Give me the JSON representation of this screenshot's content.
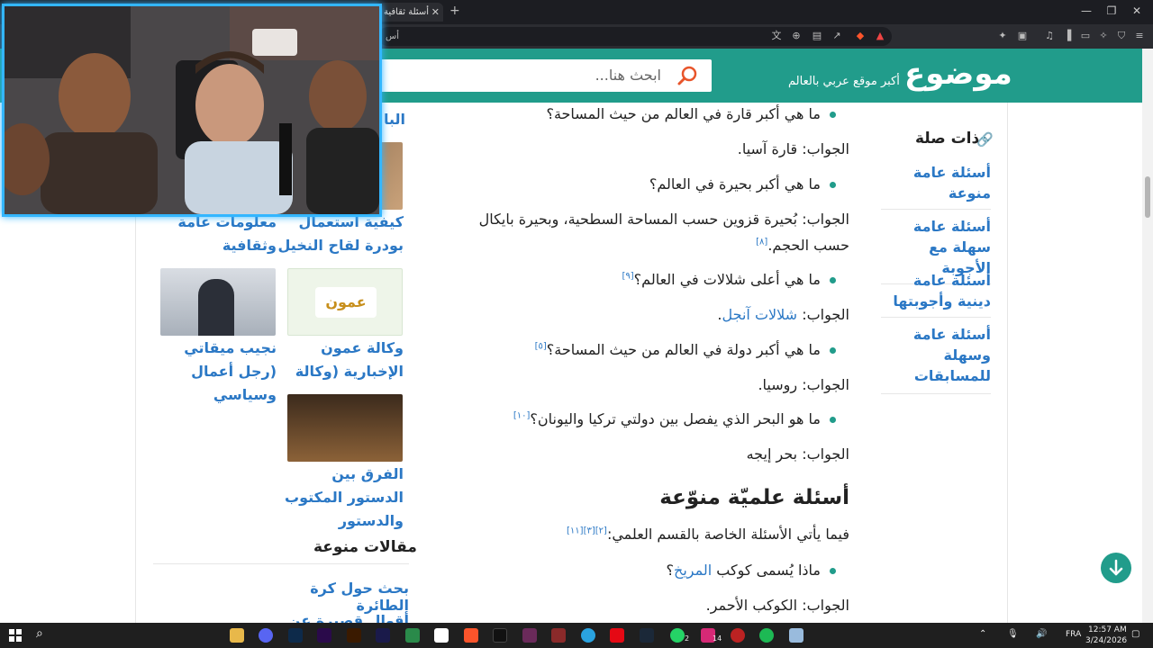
{
  "browser": {
    "tab_title": "أسئلة ثقافية",
    "tab_close": "✕",
    "new_tab": "+",
    "url_fragment": "أس",
    "window_controls": [
      "—",
      "❐",
      "✕"
    ]
  },
  "site": {
    "logo": "موضوع",
    "tagline": "أكبر موقع عربي بالعالم",
    "search_placeholder": "ابحث هنا..."
  },
  "article": {
    "items": [
      {
        "type": "q",
        "text": "ما هي أكبر قارة في العالم من حيث المساحة؟"
      },
      {
        "type": "a",
        "label": "الجواب:",
        "text": "قارة آسيا."
      },
      {
        "type": "q",
        "text": "ما هي أكبر بحيرة في العالم؟"
      },
      {
        "type": "a",
        "label": "الجواب:",
        "text": "بُحيرة قزوين حسب المساحة السطحية، وبحيرة بايكال"
      },
      {
        "type": "a2",
        "text": "حسب الحجم.",
        "sup": "[٨]"
      },
      {
        "type": "q",
        "text": "ما هي أعلى شلالات في العالم؟",
        "sup": "[٩]"
      },
      {
        "type": "a",
        "label": "الجواب:",
        "link": "شلالات آنجل",
        "text": "."
      },
      {
        "type": "q",
        "text": "ما هي أكبر دولة في العالم من حيث المساحة؟",
        "sup": "[٥]"
      },
      {
        "type": "a",
        "label": "الجواب:",
        "text": "روسيا."
      },
      {
        "type": "q",
        "text": "ما هو البحر الذي يفصل بين دولتي تركيا واليونان؟",
        "sup": "[١٠]"
      },
      {
        "type": "a",
        "label": "الجواب:",
        "text": "بحر إيجه"
      }
    ],
    "section_title": "أسئلة علميّة منوّعة",
    "section_intro": "فيما يأتي الأسئلة الخاصة بالقسم العلمي:",
    "section_intro_sup": "[٢][٣][١١]",
    "q_science": "ماذا يُسمى كوكب",
    "q_science_link": "المريخ",
    "q_science_end": "؟",
    "a_science_label": "الجواب:",
    "a_science": "الكوكب الأحمر."
  },
  "related": {
    "title": "ذات صلة",
    "items": [
      "أسئلة عامة منوعة",
      "أسئلة عامة سهلة مع الأجوبة",
      "أسئلة عامة دينية وأجوبتها",
      "أسئلة عامة وسهلة للمسابقات"
    ]
  },
  "sidebar": {
    "cut_title": "البا",
    "cards": [
      {
        "title": "كيفية استعمال بودرة لقاح النخيل"
      },
      {
        "title": "معلومات عامة وثقافية"
      },
      {
        "title": "وكالة عمون الإخبارية (وكالة"
      },
      {
        "title": "نجيب ميقاتي (رجل أعمال وسياسي"
      },
      {
        "title": "الفرق بين الدستور المكتوب والدستور"
      }
    ],
    "ammon_logo": "عمون",
    "varia_title": "مقالات منوعة",
    "varia": [
      "بحث حول كرة الطائرة",
      "أقوال قصيرة عن الحب"
    ]
  },
  "taskbar": {
    "time": "12:57 AM",
    "date": "3/24/2026",
    "lang": "FRA",
    "badge_whatsapp": "2",
    "badge_insta": "14"
  },
  "colors": {
    "brand": "#219c8b",
    "link": "#2b78c5",
    "cam_border": "#33b6ff"
  }
}
